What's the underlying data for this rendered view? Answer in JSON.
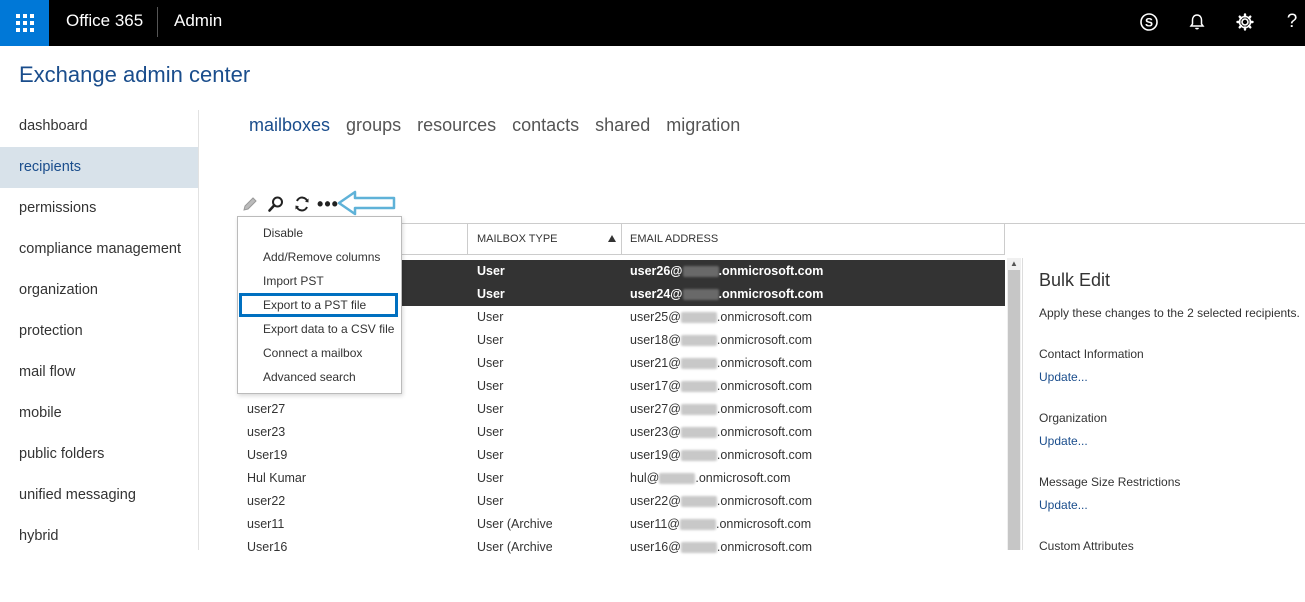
{
  "topbar": {
    "app_name": "Office 365",
    "section": "Admin",
    "help": "?"
  },
  "page": {
    "title": "Exchange admin center"
  },
  "nav": {
    "items": [
      "dashboard",
      "recipients",
      "permissions",
      "compliance management",
      "organization",
      "protection",
      "mail flow",
      "mobile",
      "public folders",
      "unified messaging",
      "hybrid"
    ],
    "active_index": 1
  },
  "tabs": {
    "items": [
      "mailboxes",
      "groups",
      "resources",
      "contacts",
      "shared",
      "migration"
    ],
    "active_index": 0
  },
  "toolbar": {
    "more": "•••"
  },
  "menu": {
    "items": [
      "Disable",
      "Add/Remove columns",
      "Import PST",
      "Export to a PST file",
      "Export data to a CSV file",
      "Connect a mailbox",
      "Advanced search"
    ],
    "highlight_index": 3
  },
  "table": {
    "headers": {
      "mailbox_type": "MAILBOX TYPE",
      "email": "EMAIL ADDRESS"
    },
    "rows": [
      {
        "name": "",
        "type": "User",
        "email_user": "user26@",
        "email_domain": ".onmicrosoft.com",
        "selected": true
      },
      {
        "name": "",
        "type": "User",
        "email_user": "user24@",
        "email_domain": ".onmicrosoft.com",
        "selected": true
      },
      {
        "name": "",
        "type": "User",
        "email_user": "user25@",
        "email_domain": ".onmicrosoft.com",
        "selected": false
      },
      {
        "name": "",
        "type": "User",
        "email_user": "user18@",
        "email_domain": ".onmicrosoft.com",
        "selected": false
      },
      {
        "name": "",
        "type": "User",
        "email_user": "user21@",
        "email_domain": ".onmicrosoft.com",
        "selected": false
      },
      {
        "name": "",
        "type": "User",
        "email_user": "user17@",
        "email_domain": ".onmicrosoft.com",
        "selected": false
      },
      {
        "name": "user27",
        "type": "User",
        "email_user": "user27@",
        "email_domain": ".onmicrosoft.com",
        "selected": false
      },
      {
        "name": "user23",
        "type": "User",
        "email_user": "user23@",
        "email_domain": ".onmicrosoft.com",
        "selected": false
      },
      {
        "name": "User19",
        "type": "User",
        "email_user": "user19@",
        "email_domain": ".onmicrosoft.com",
        "selected": false
      },
      {
        "name": "Hul Kumar",
        "type": "User",
        "email_user": "hul@",
        "email_domain": ".onmicrosoft.com",
        "selected": false
      },
      {
        "name": "user22",
        "type": "User",
        "email_user": "user22@",
        "email_domain": ".onmicrosoft.com",
        "selected": false
      },
      {
        "name": "user11",
        "type": "User (Archive)",
        "email_user": "user11@",
        "email_domain": ".onmicrosoft.com",
        "selected": false
      },
      {
        "name": "User16",
        "type": "User (Archive)",
        "email_user": "user16@",
        "email_domain": ".onmicrosoft.com",
        "selected": false
      }
    ]
  },
  "bulk_edit": {
    "title": "Bulk Edit",
    "description": "Apply these changes to the 2 selected recipients.",
    "sections": [
      {
        "label": "Contact Information",
        "link": "Update..."
      },
      {
        "label": "Organization",
        "link": "Update..."
      },
      {
        "label": "Message Size Restrictions",
        "link": "Update..."
      },
      {
        "label": "Custom Attributes",
        "link": ""
      }
    ]
  },
  "colors": {
    "brand": "#0078d7",
    "accent": "#1a4d8c",
    "highlight": "#0070c0",
    "callout": "#5fb2d8"
  }
}
